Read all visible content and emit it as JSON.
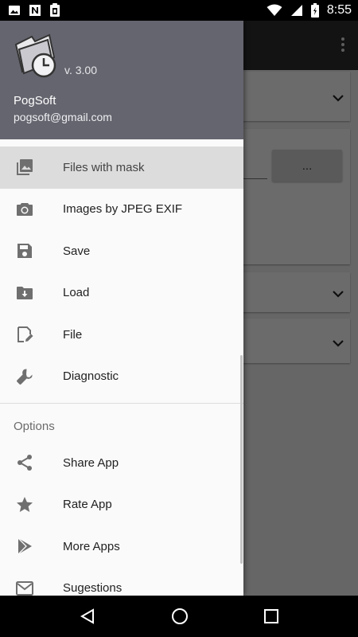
{
  "status_bar": {
    "time": "8:55",
    "left_icons": [
      "image-icon",
      "n-app-icon",
      "clipboard-icon"
    ],
    "right_icons": [
      "wifi-icon",
      "signal-icon",
      "battery-icon"
    ]
  },
  "background": {
    "dots_button_label": "..."
  },
  "drawer": {
    "header": {
      "version": "v. 3.00",
      "user_name": "PogSoft",
      "user_email": "pogsoft@gmail.com"
    },
    "items": [
      {
        "label": "Files with mask",
        "icon": "image-icon",
        "selected": true
      },
      {
        "label": "Images by JPEG EXIF",
        "icon": "camera-icon",
        "selected": false
      },
      {
        "label": "Save",
        "icon": "save-icon",
        "selected": false
      },
      {
        "label": "Load",
        "icon": "folder-download-icon",
        "selected": false
      },
      {
        "label": "File",
        "icon": "file-edit-icon",
        "selected": false
      },
      {
        "label": "Diagnostic",
        "icon": "wrench-icon",
        "selected": false
      }
    ],
    "options_header": "Options",
    "options": [
      {
        "label": "Share App",
        "icon": "share-icon"
      },
      {
        "label": "Rate App",
        "icon": "star-icon"
      },
      {
        "label": "More Apps",
        "icon": "play-store-icon"
      },
      {
        "label": "Sugestions",
        "icon": "mail-icon"
      }
    ]
  },
  "nav_bar": {
    "icons": [
      "back-icon",
      "home-icon",
      "recents-icon"
    ]
  },
  "colors": {
    "header_bg": "#65656f",
    "toolbar_bg": "#2f2f2f",
    "selected_bg": "#dcdcdc",
    "icon_gray": "#6f6f6f"
  }
}
